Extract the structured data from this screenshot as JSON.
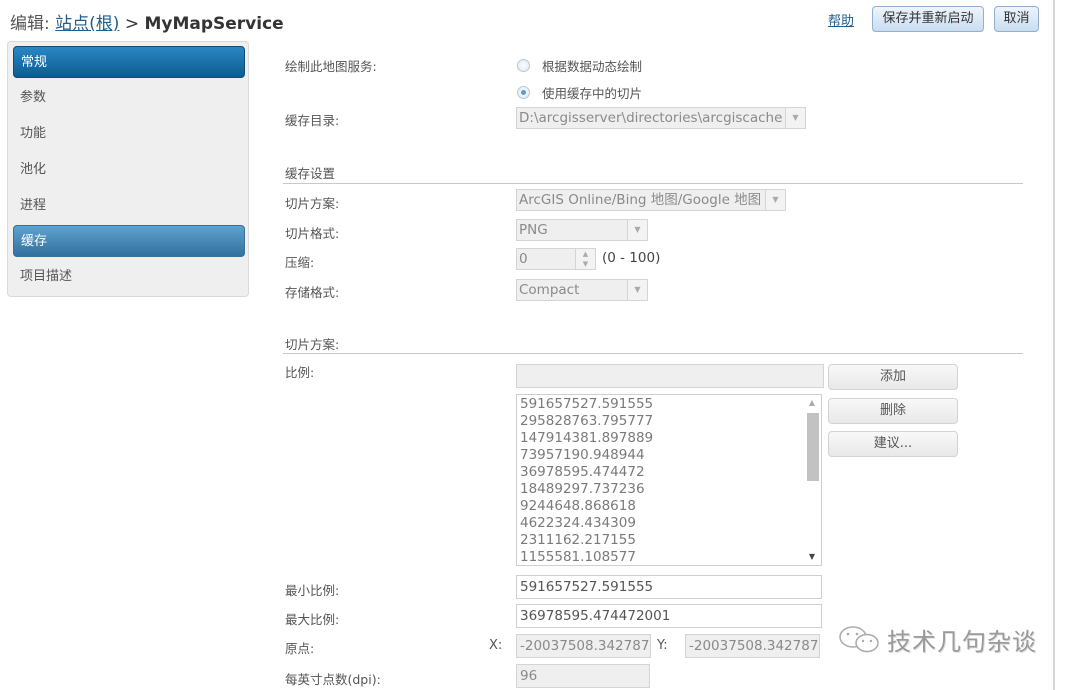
{
  "header": {
    "prefix": "编辑:",
    "breadcrumb_root": "站点(根)",
    "separator": ">",
    "service_name": "MyMapService",
    "help_label": "帮助",
    "save_restart_label": "保存并重新启动",
    "cancel_label": "取消"
  },
  "sidebar": {
    "items": [
      {
        "label": "常规",
        "state": "active"
      },
      {
        "label": "参数",
        "state": "normal"
      },
      {
        "label": "功能",
        "state": "normal"
      },
      {
        "label": "池化",
        "state": "normal"
      },
      {
        "label": "进程",
        "state": "normal"
      },
      {
        "label": "缓存",
        "state": "selected"
      },
      {
        "label": "项目描述",
        "state": "normal"
      }
    ]
  },
  "draw_service": {
    "label": "绘制此地图服务:",
    "options": [
      {
        "label": "根据数据动态绘制",
        "checked": false
      },
      {
        "label": "使用缓存中的切片",
        "checked": true
      }
    ]
  },
  "cache_dir": {
    "label": "缓存目录:",
    "value": "D:\\arcgisserver\\directories\\arcgiscache"
  },
  "cache_settings": {
    "section_title": "缓存设置",
    "tiling_scheme": {
      "label": "切片方案:",
      "value": "ArcGIS Online/Bing 地图/Google 地图"
    },
    "tile_format": {
      "label": "切片格式:",
      "value": "PNG"
    },
    "compression": {
      "label": "压缩:",
      "value": "0",
      "range": "(0 - 100)"
    },
    "storage_format": {
      "label": "存储格式:",
      "value": "Compact"
    }
  },
  "tiling": {
    "section_title": "切片方案:",
    "scales_label": "比例:",
    "scale_input_value": "",
    "scales": [
      "591657527.591555",
      "295828763.795777",
      "147914381.897889",
      "73957190.948944",
      "36978595.474472",
      "18489297.737236",
      "9244648.868618",
      "4622324.434309",
      "2311162.217155",
      "1155581.108577"
    ],
    "add_label": "添加",
    "delete_label": "删除",
    "suggest_label": "建议...",
    "min_scale": {
      "label": "最小比例:",
      "value": "591657527.591555"
    },
    "max_scale": {
      "label": "最大比例:",
      "value": "36978595.474472001"
    },
    "origin": {
      "label": "原点:",
      "x_label": "X:",
      "x_value": "-20037508.342787",
      "y_label": "Y:",
      "y_value": "-20037508.342787"
    },
    "dpi": {
      "label": "每英寸点数(dpi):",
      "value": "96"
    }
  },
  "watermark": {
    "icon": "wechat-icon",
    "text": "技术几句杂谈"
  },
  "icons": {
    "dropdown": "▼",
    "spin_up": "▲",
    "spin_down": "▼",
    "scroll_up": "▲",
    "scroll_down": "▼"
  }
}
